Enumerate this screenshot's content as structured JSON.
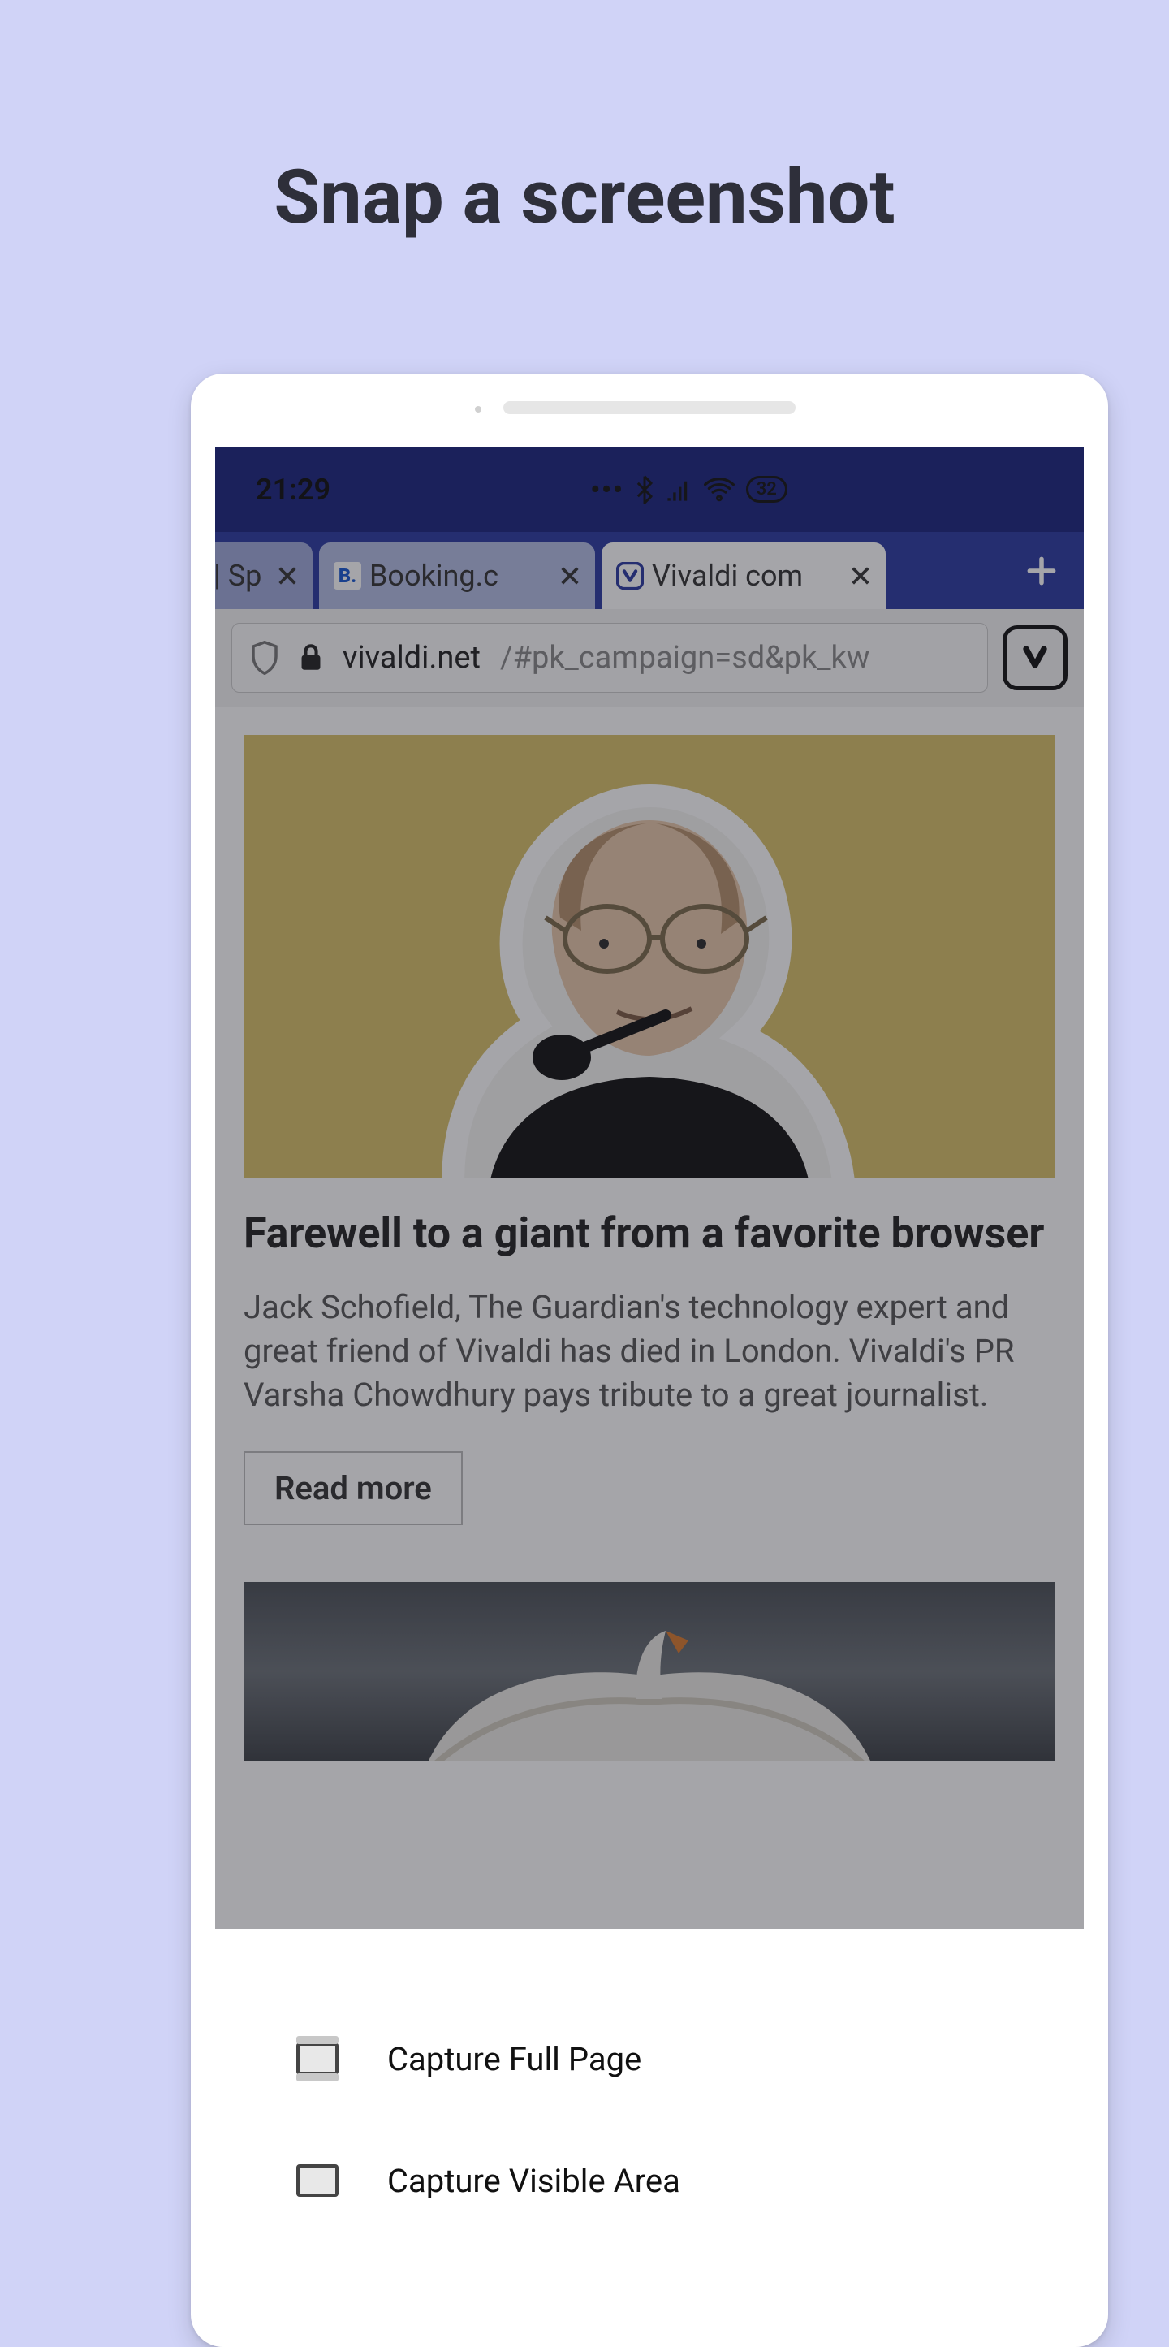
{
  "title": "Snap a screenshot",
  "statusbar": {
    "time": "21:29",
    "battery": "32"
  },
  "tabs": [
    {
      "label": " | Sp"
    },
    {
      "label": "Booking.c",
      "favicon_letter": "B."
    },
    {
      "label": "Vivaldi com"
    }
  ],
  "addressbar": {
    "host": "vivaldi.net",
    "path": "/#pk_campaign=sd&pk_kw"
  },
  "article": {
    "title": "Farewell to a giant from a favorite browser",
    "body": "Jack Schofield, The Guardian's technology expert and great friend of Vivaldi has died in London. Vivaldi's PR Varsha Chowdhury pays tribute to a great journalist.",
    "readmore": "Read more"
  },
  "sheet": {
    "item1": "Capture Full Page",
    "item2": "Capture Visible Area"
  }
}
